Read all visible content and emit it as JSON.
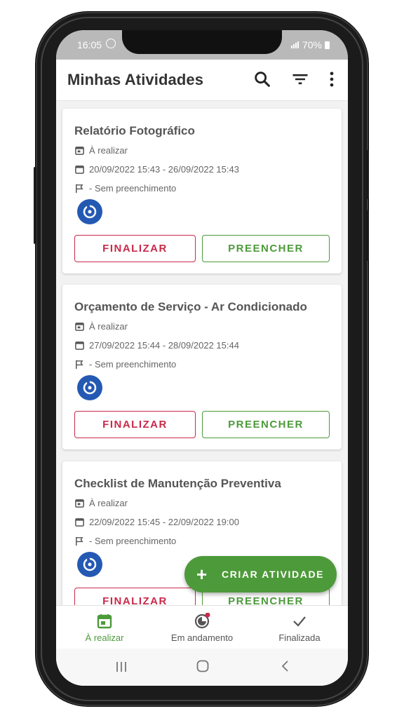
{
  "status_bar": {
    "time": "16:05",
    "battery": "70%"
  },
  "app_bar": {
    "title": "Minhas Atividades",
    "actions": [
      "search-icon",
      "filter-icon",
      "more-vert-icon"
    ]
  },
  "cards": [
    {
      "title": "Relatório Fotográfico",
      "status": "À realizar",
      "dates": "20/09/2022 15:43 - 26/09/2022 15:43",
      "fill": "- Sem preenchimento",
      "finish_label": "FINALIZAR",
      "fill_label": "PREENCHER"
    },
    {
      "title": "Orçamento de Serviço - Ar Condicionado",
      "status": "À realizar",
      "dates": "27/09/2022 15:44 - 28/09/2022 15:44",
      "fill": "- Sem preenchimento",
      "finish_label": "FINALIZAR",
      "fill_label": "PREENCHER"
    },
    {
      "title": "Checklist de Manutenção Preventiva",
      "status": "À realizar",
      "dates": "22/09/2022 15:45 - 22/09/2022 19:00",
      "fill": "- Sem preenchimento",
      "finish_label": "FINALIZAR",
      "fill_label": "PREENCHER"
    }
  ],
  "fab": {
    "label": "CRIAR ATIVIDADE"
  },
  "bottom_nav": [
    {
      "label": "À realizar",
      "icon": "calendar-icon",
      "active": true
    },
    {
      "label": "Em andamento",
      "icon": "progress-icon",
      "badge": true
    },
    {
      "label": "Finalizada",
      "icon": "check-icon"
    }
  ],
  "colors": {
    "primary": "#4d9a3a",
    "danger": "#c9294a",
    "avatar": "#2459b3",
    "badge": "#c9294a"
  }
}
